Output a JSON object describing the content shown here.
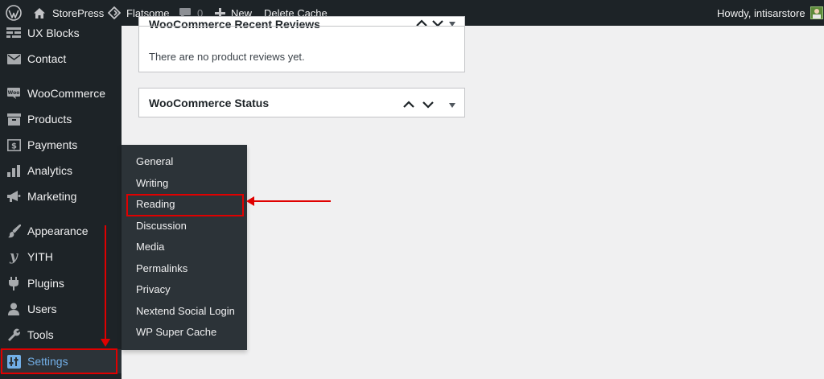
{
  "admin_bar": {
    "site_name": "StorePress",
    "theme_name": "Flatsome",
    "comments_count": "0",
    "new_label": "New",
    "delete_cache_label": "Delete Cache",
    "greeting": "Howdy, intisarstore"
  },
  "sidebar": {
    "items": [
      {
        "label": "UX Blocks",
        "icon": "grid-icon"
      },
      {
        "label": "Contact",
        "icon": "mail-icon"
      },
      {
        "label": "WooCommerce",
        "icon": "woo-icon"
      },
      {
        "label": "Products",
        "icon": "archive-icon"
      },
      {
        "label": "Payments",
        "icon": "dollar-icon"
      },
      {
        "label": "Analytics",
        "icon": "bar-chart-icon"
      },
      {
        "label": "Marketing",
        "icon": "megaphone-icon"
      },
      {
        "label": "Appearance",
        "icon": "paintbrush-icon"
      },
      {
        "label": "YITH",
        "icon": "yith-icon"
      },
      {
        "label": "Plugins",
        "icon": "plug-icon"
      },
      {
        "label": "Users",
        "icon": "user-icon"
      },
      {
        "label": "Tools",
        "icon": "wrench-icon"
      },
      {
        "label": "Settings",
        "icon": "settings-icon"
      }
    ]
  },
  "settings_submenu": {
    "items": [
      "General",
      "Writing",
      "Reading",
      "Discussion",
      "Media",
      "Permalinks",
      "Privacy",
      "Nextend Social Login",
      "WP Super Cache"
    ],
    "highlighted": "Reading"
  },
  "widgets": {
    "recent_reviews": {
      "title": "WooCommerce Recent Reviews",
      "empty_text": "There are no product reviews yet."
    },
    "status": {
      "title": "WooCommerce Status"
    }
  },
  "colors": {
    "admin_dark": "#1d2327",
    "submenu_bg": "#2c3338",
    "current_text": "#72aee6",
    "highlight_red": "#e00000",
    "content_bg": "#f0f0f1"
  }
}
